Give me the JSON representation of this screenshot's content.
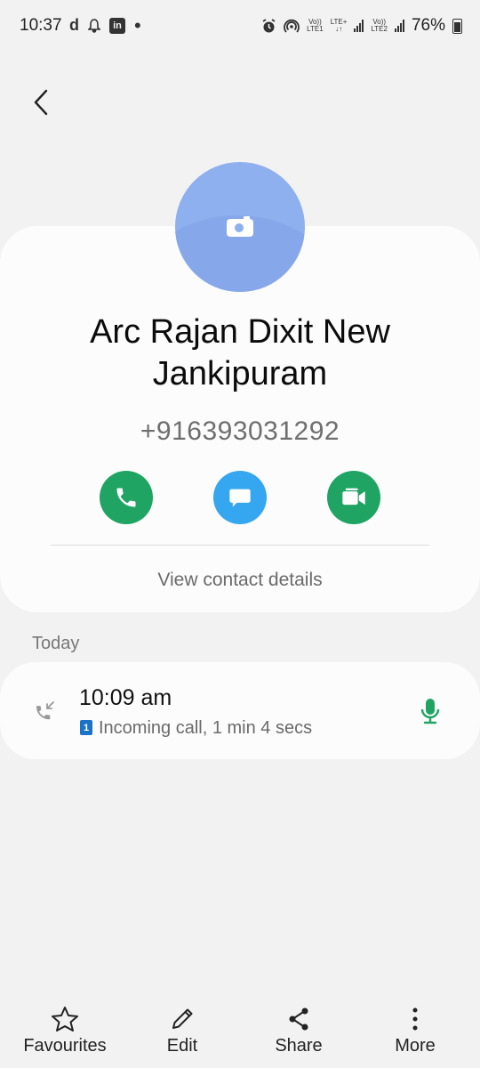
{
  "status_bar": {
    "time": "10:37",
    "left_icons": [
      "d-icon",
      "notification-bell-icon",
      "linkedin-icon",
      "dot-icon"
    ],
    "right": {
      "lte_label": "LTE+",
      "volte1_top": "Vo))",
      "volte1_bottom": "LTE1",
      "volte2_top": "Vo))",
      "volte2_bottom": "LTE2",
      "battery": "76%"
    }
  },
  "contact": {
    "name": "Arc Rajan Dixit New Jankipuram",
    "phone": "+916393031292",
    "actions": [
      "call",
      "message",
      "video-call"
    ],
    "view_details_label": "View contact details"
  },
  "call_log": {
    "section_label": "Today",
    "entries": [
      {
        "time": "10:09 am",
        "sim": "1",
        "description": "Incoming call, 1 min 4 secs",
        "type": "incoming"
      }
    ]
  },
  "bottom_nav": {
    "items": [
      {
        "label": "Favourites",
        "icon": "star-icon"
      },
      {
        "label": "Edit",
        "icon": "pencil-icon"
      },
      {
        "label": "Share",
        "icon": "share-icon"
      },
      {
        "label": "More",
        "icon": "more-vertical-icon"
      }
    ]
  },
  "colors": {
    "background": "#f2f2f2",
    "card": "#fcfcfc",
    "avatar": "#8fb0ef",
    "call_green": "#1fa463",
    "message_blue": "#35a6f0",
    "sim_badge": "#1a73c9",
    "mic_green": "#1fa463"
  }
}
